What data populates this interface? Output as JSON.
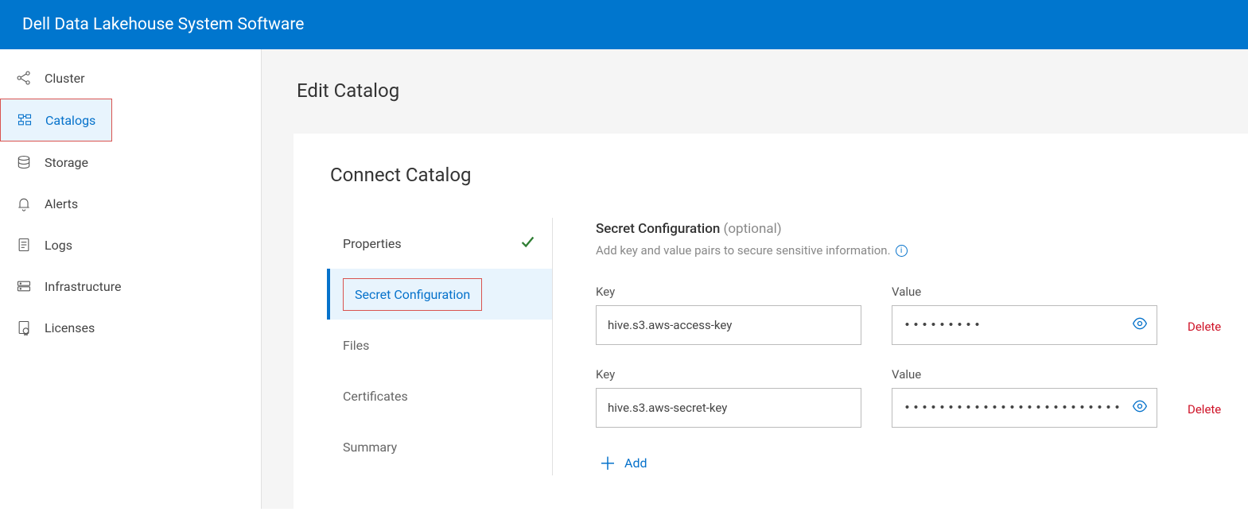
{
  "header": {
    "title": "Dell Data Lakehouse System Software"
  },
  "sidebar": {
    "items": [
      {
        "label": "Cluster"
      },
      {
        "label": "Catalogs"
      },
      {
        "label": "Storage"
      },
      {
        "label": "Alerts"
      },
      {
        "label": "Logs"
      },
      {
        "label": "Infrastructure"
      },
      {
        "label": "Licenses"
      }
    ]
  },
  "page": {
    "title": "Edit Catalog",
    "section_title": "Connect Catalog"
  },
  "steps": [
    {
      "label": "Properties"
    },
    {
      "label": "Secret Configuration"
    },
    {
      "label": "Files"
    },
    {
      "label": "Certificates"
    },
    {
      "label": "Summary"
    }
  ],
  "form": {
    "title": "Secret Configuration",
    "optional": " (optional)",
    "desc": "Add key and value pairs to secure sensitive information.",
    "key_label": "Key",
    "value_label": "Value",
    "delete_label": "Delete",
    "add_label": "Add",
    "rows": [
      {
        "key": "hive.s3.aws-access-key",
        "value": "•••••••••"
      },
      {
        "key": "hive.s3.aws-secret-key",
        "value": "•••••••••••••••••••••••••••••••••••••••••"
      }
    ]
  }
}
